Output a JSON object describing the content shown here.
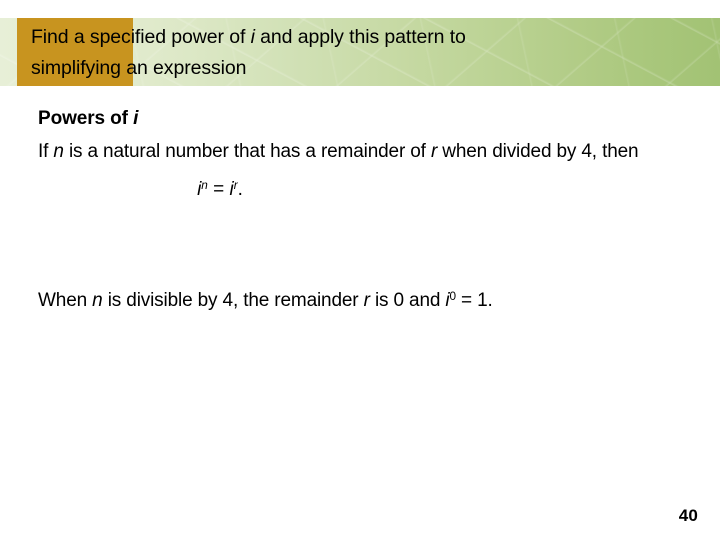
{
  "slide": {
    "title": {
      "line1_before_i": "Find a specified power of ",
      "line1_i": "i",
      "line1_after_i": " and apply this pattern to",
      "line2": "simplifying an expression",
      "gold_block_color": "#c8941f",
      "green_start_color": "#e7efd7",
      "green_end_color": "#a2c274"
    },
    "body": {
      "heading_text": "Powers of ",
      "heading_italic": "i",
      "para1_part1": "If ",
      "para1_n": "n",
      "para1_part2": " is a natural number that has a remainder of ",
      "para1_r": "r",
      "para1_part3": " when divided by 4, then",
      "formula": {
        "base1": "i",
        "exp1": "n",
        "equals": " = ",
        "base2": "i",
        "exp2": "r",
        "period": "."
      },
      "para2_part1": "When ",
      "para2_n": "n",
      "para2_part2": " is divisible by 4, the remainder ",
      "para2_r": "r",
      "para2_part3": " is 0 and ",
      "para2_base": "i",
      "para2_exp": "0",
      "para2_part4": " = 1."
    },
    "page_number": "40"
  }
}
